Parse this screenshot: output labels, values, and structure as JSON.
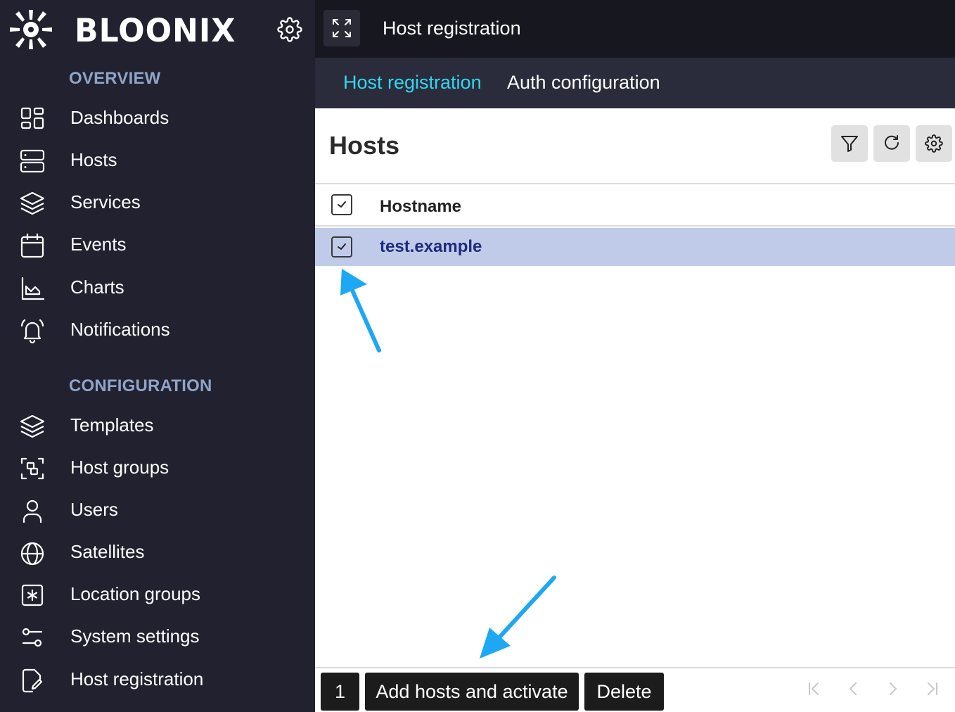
{
  "brand": {
    "name": "BLOONIX"
  },
  "sidebar": {
    "sections": [
      {
        "title": "OVERVIEW",
        "items": [
          {
            "label": "Dashboards",
            "icon": "dashboard-icon"
          },
          {
            "label": "Hosts",
            "icon": "server-icon"
          },
          {
            "label": "Services",
            "icon": "layers-icon"
          },
          {
            "label": "Events",
            "icon": "calendar-icon"
          },
          {
            "label": "Charts",
            "icon": "chart-icon"
          },
          {
            "label": "Notifications",
            "icon": "bell-icon"
          }
        ]
      },
      {
        "title": "CONFIGURATION",
        "items": [
          {
            "label": "Templates",
            "icon": "layers-icon"
          },
          {
            "label": "Host groups",
            "icon": "group-icon"
          },
          {
            "label": "Users",
            "icon": "user-icon"
          },
          {
            "label": "Satellites",
            "icon": "globe-icon"
          },
          {
            "label": "Location groups",
            "icon": "asterisk-box-icon"
          },
          {
            "label": "System settings",
            "icon": "sliders-icon"
          },
          {
            "label": "Host registration",
            "icon": "edit-document-icon"
          }
        ]
      }
    ]
  },
  "topbar": {
    "title": "Host registration"
  },
  "tabs": [
    {
      "label": "Host registration",
      "active": true
    },
    {
      "label": "Auth configuration",
      "active": false
    }
  ],
  "main": {
    "title": "Hosts",
    "table": {
      "columns": [
        "Hostname"
      ],
      "rows": [
        {
          "hostname": "test.example",
          "selected": true
        }
      ]
    },
    "footer": {
      "selected_count": "1",
      "add_label": "Add hosts and activate",
      "delete_label": "Delete"
    }
  },
  "colors": {
    "sidebar_bg": "#212130",
    "topbar_bg": "#17171f",
    "tabs_bg": "#2a2b3b",
    "active_tab": "#33d7ee",
    "section_title": "#8fa4c8",
    "selected_row": "#c0cbea",
    "annotation_arrow": "#1ea7f2"
  }
}
